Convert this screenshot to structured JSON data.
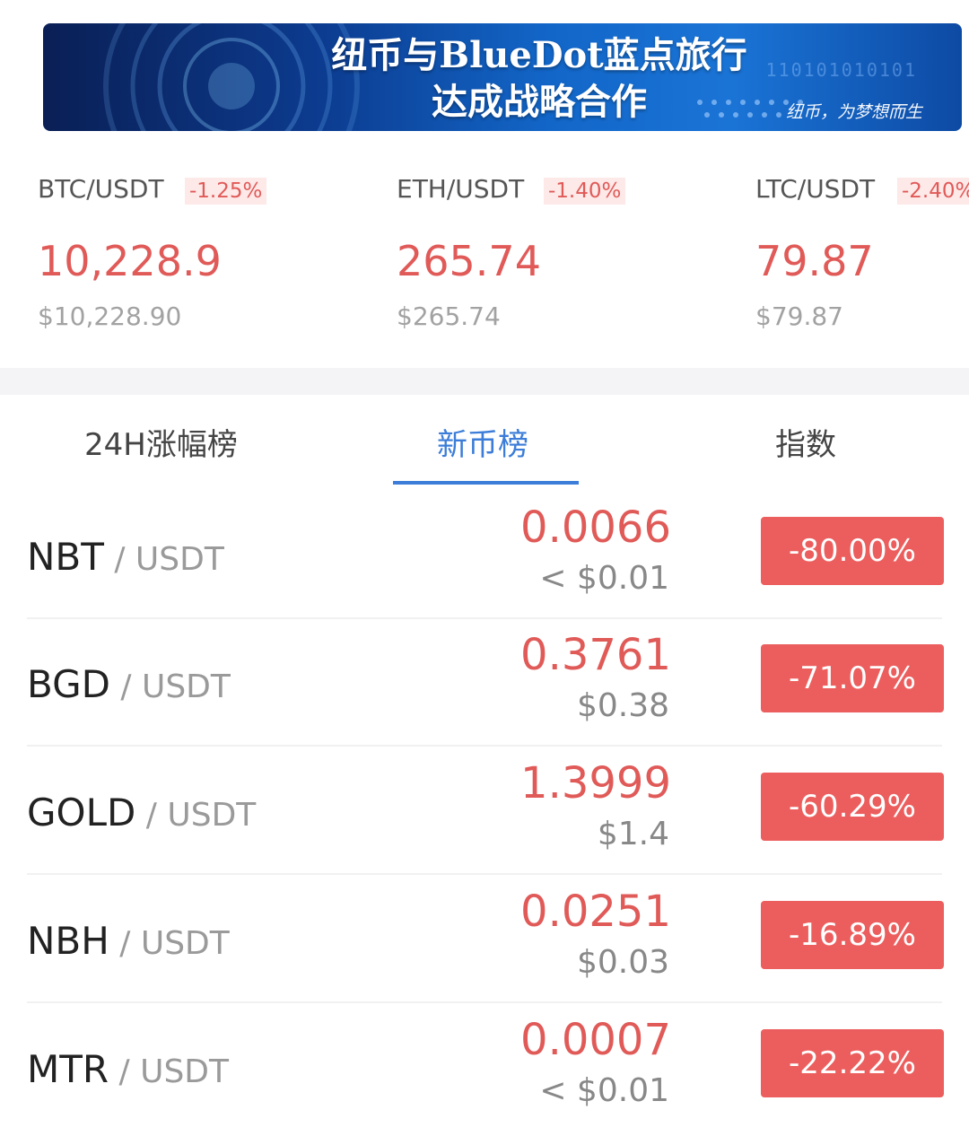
{
  "banner": {
    "title_line1": "纽币与BlueDot蓝点旅行",
    "title_line2": "达成战略合作",
    "slogan": "纽币，为梦想而生",
    "binary": "110101010101"
  },
  "tickers": [
    {
      "pair": "BTC/USDT",
      "change": "-1.25%",
      "price": "10,228.9",
      "usd": "$10,228.90"
    },
    {
      "pair": "ETH/USDT",
      "change": "-1.40%",
      "price": "265.74",
      "usd": "$265.74"
    },
    {
      "pair": "LTC/USDT",
      "change": "-2.40%",
      "price": "79.87",
      "usd": "$79.87"
    }
  ],
  "tabs": [
    {
      "label": "24H涨幅榜"
    },
    {
      "label": "新币榜"
    },
    {
      "label": "指数"
    }
  ],
  "active_tab": "新币榜",
  "rows": [
    {
      "base": "NBT",
      "quote": " / USDT",
      "price": "0.0066",
      "usd": "< $0.01",
      "change": "-80.00%"
    },
    {
      "base": "BGD",
      "quote": " / USDT",
      "price": "0.3761",
      "usd": "$0.38",
      "change": "-71.07%"
    },
    {
      "base": "GOLD",
      "quote": " / USDT",
      "price": "1.3999",
      "usd": "$1.4",
      "change": "-60.29%"
    },
    {
      "base": "NBH",
      "quote": " / USDT",
      "price": "0.0251",
      "usd": "$0.03",
      "change": "-16.89%"
    },
    {
      "base": "MTR",
      "quote": " / USDT",
      "price": "0.0007",
      "usd": "< $0.01",
      "change": "-22.22%"
    }
  ],
  "colors": {
    "down": "#e05a58",
    "badge_down": "#ec5e5e",
    "accent": "#3b7dd8",
    "banner": "#1266c8"
  }
}
